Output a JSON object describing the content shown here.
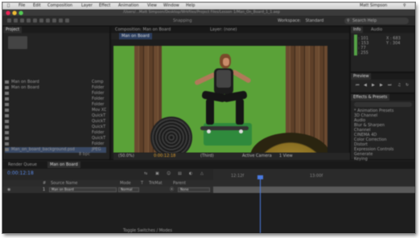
{
  "menubar": {
    "items": [
      "File",
      "Edit",
      "Composition",
      "Layer",
      "Effect",
      "Animation",
      "View",
      "Window",
      "Help"
    ],
    "user": "Matt Simpson"
  },
  "titlebar": {
    "title": "Adobe After Effects CC 2014 - Untitled Project.aep *",
    "path": "/Users/...Matt Simpson/Desktop/Wrkfiles/Project Files/Lesson 1/Man_On_Board_1_1.aep"
  },
  "toolbar": {
    "snapping_label": "Snapping",
    "workspace_label": "Workspace:",
    "workspace_value": "Standard",
    "search_placeholder": "Search Help"
  },
  "project_panel": {
    "tab_label": "Project",
    "rows": [
      {
        "name": "Man on Board",
        "type": "Comp"
      },
      {
        "name": "Man on Board",
        "type": "Folder"
      },
      {
        "name": "",
        "type": "Folder"
      },
      {
        "name": "",
        "type": "Folder"
      },
      {
        "name": "",
        "type": "Folder"
      },
      {
        "name": "",
        "type": "Mov XD"
      },
      {
        "name": "",
        "type": "QuickT"
      },
      {
        "name": "",
        "type": "QuickT"
      },
      {
        "name": "",
        "type": "QuickT"
      },
      {
        "name": "",
        "type": "Folder"
      },
      {
        "name": "",
        "type": "QuickT"
      },
      {
        "name": "",
        "type": "Folder"
      },
      {
        "name": "Man_on_board_background.psd",
        "type": "JPEG"
      }
    ],
    "bit_depth": "8 bpc"
  },
  "composition_panel": {
    "header": "Composition: Man on Board",
    "layer_label": "Layer: (none)",
    "tabs": [
      "Man on Board"
    ],
    "zoom": "(50.0%)",
    "timecode": "0:00:12:18",
    "resolution": "(Third)",
    "camera": "Active Camera",
    "views": "1 View"
  },
  "info_panel": {
    "tabs": [
      "Info",
      "Audio"
    ],
    "r": "R : 101",
    "g": "G : 153",
    "b": "B : 77",
    "a": "A : 255",
    "x": "X : 683",
    "y": "Y : 304",
    "swatch_color": "#54a246"
  },
  "preview_panel": {
    "tab": "Preview"
  },
  "effects_panel": {
    "tab": "Effects & Presets",
    "items": [
      "* Animation Presets",
      "3D Channel",
      "Audio",
      "Blur & Sharpen",
      "Channel",
      "CINEMA 4D",
      "Color Correction",
      "Distort",
      "Expression Controls",
      "Generate",
      "Keying"
    ]
  },
  "timeline": {
    "tabs": [
      "Render Queue",
      "Man on Board"
    ],
    "timecode": "0:00:12:18",
    "columns": [
      "#",
      "Source Name",
      "Mode",
      "T",
      "TrkMat",
      "Parent"
    ],
    "layer": {
      "index": "1",
      "name": "Man on Board",
      "mode": "Normal",
      "parent": "None"
    },
    "ruler_marks": [
      "12:12f",
      "13:00f"
    ],
    "footer": "Toggle Switches / Modes"
  }
}
